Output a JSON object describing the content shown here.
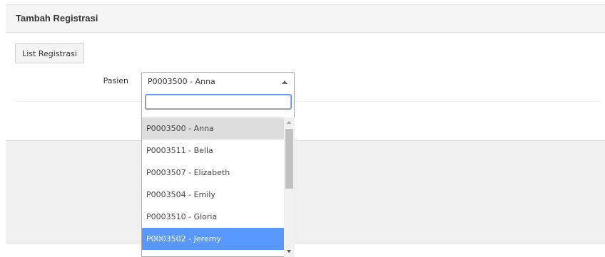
{
  "header": {
    "title": "Tambah Registrasi"
  },
  "toolbar": {
    "list_button_label": "List Registrasi"
  },
  "form": {
    "pasien_label": "Pasien",
    "pasien_selected": "P0003500 - Anna"
  },
  "dropdown": {
    "search_value": "",
    "options": [
      {
        "label": "P0003500 - Anna",
        "state": "selected"
      },
      {
        "label": "P0003511 - Bella",
        "state": "normal"
      },
      {
        "label": "P0003507 - Elizabeth",
        "state": "normal"
      },
      {
        "label": "P0003504 - Emily",
        "state": "normal"
      },
      {
        "label": "P0003510 - Gloria",
        "state": "normal"
      },
      {
        "label": "P0003502 - Jeremy",
        "state": "highlighted"
      }
    ]
  },
  "colors": {
    "highlight": "#5897fb",
    "selected_bg": "#dddddd",
    "header_bg": "#f5f5f5"
  },
  "icons": {
    "select_toggle": "triangle-up-icon",
    "scroll_up": "scroll-up-arrow-icon",
    "scroll_down": "scroll-down-arrow-icon"
  }
}
